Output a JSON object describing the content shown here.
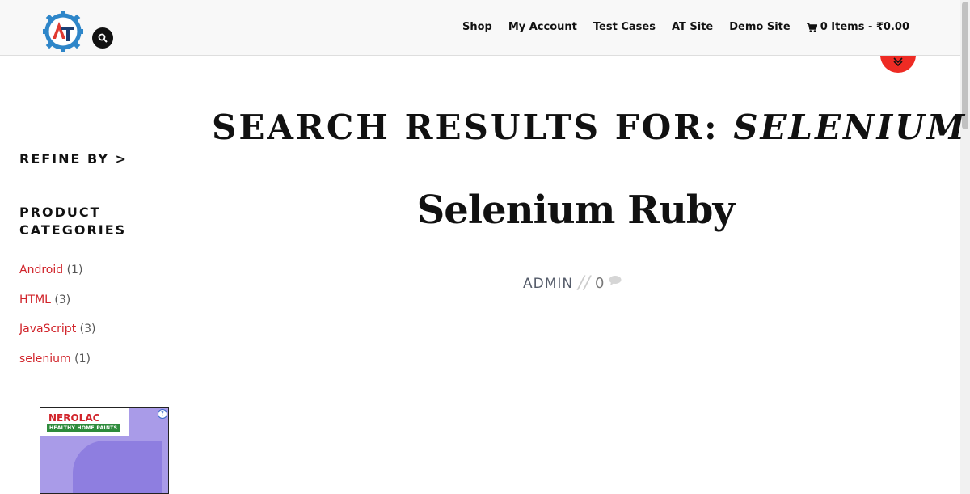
{
  "header": {
    "nav": {
      "shop": "Shop",
      "my_account": "My Account",
      "test_cases": "Test Cases",
      "at_site": "AT Site",
      "demo_site": "Demo Site",
      "cart": "0 Items - ₹0.00"
    },
    "icons": {
      "search": "search-icon",
      "cart": "cart-icon",
      "scroll": "chevron-double-down-icon"
    },
    "accent_color": "#ee2b24"
  },
  "main": {
    "title_prefix": "SEARCH RESULTS FOR: ",
    "title_query": "SELENIUM",
    "post": {
      "title": "Selenium Ruby",
      "author": "ADMIN",
      "separator": "//",
      "comments": "0"
    }
  },
  "sidebar": {
    "refine": "REFINE BY >",
    "categories_heading": "PRODUCT CATEGORIES",
    "categories": [
      {
        "label": "Android",
        "count": "(1)"
      },
      {
        "label": "HTML",
        "count": "(3)"
      },
      {
        "label": "JavaScript",
        "count": "(3)"
      },
      {
        "label": "selenium",
        "count": "(1)"
      }
    ],
    "link_color": "#d1232a"
  },
  "ad": {
    "brand": "NEROLAC",
    "tagline": "HEALTHY HOME PAINTS",
    "info": "?"
  }
}
